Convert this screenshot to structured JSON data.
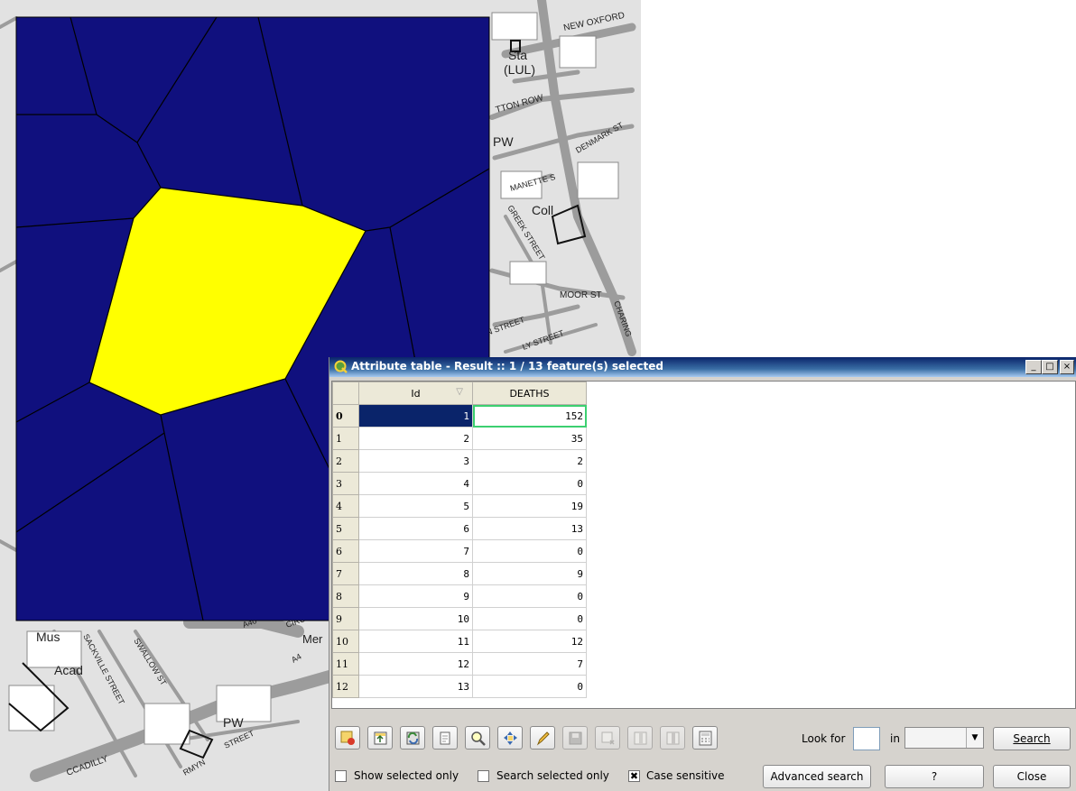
{
  "map": {
    "labels": [
      "Sta",
      "(LUL)",
      "NEW OXFORD",
      "TTON ROW",
      "PW",
      "DENMARK ST",
      "MANETTE S",
      "Coll",
      "GREEK STREET",
      "MOOR ST",
      "CHARING",
      "N STREET",
      "LY STREET",
      "Mus",
      "Acad",
      "SACKVILLE STREET",
      "SWALLOW ST",
      "A4",
      "Mer",
      "PW",
      "STREET",
      "CCADILLY",
      "RMYN",
      "CIRCE",
      "A40"
    ],
    "colors": {
      "polygon_fill": "#10107e",
      "selected_fill": "#ffff00",
      "edge": "#000000",
      "background": "#e4e4e4",
      "road": "#9a9a9a"
    }
  },
  "window": {
    "title": "Attribute table - Result :: 1 / 13 feature(s) selected",
    "minimize": "_",
    "maximize": "□",
    "close": "×"
  },
  "table": {
    "columns": [
      "Id",
      "DEATHS"
    ],
    "rows": [
      {
        "row": "0",
        "id": "1",
        "deaths": "152"
      },
      {
        "row": "1",
        "id": "2",
        "deaths": "35"
      },
      {
        "row": "2",
        "id": "3",
        "deaths": "2"
      },
      {
        "row": "3",
        "id": "4",
        "deaths": "0"
      },
      {
        "row": "4",
        "id": "5",
        "deaths": "19"
      },
      {
        "row": "5",
        "id": "6",
        "deaths": "13"
      },
      {
        "row": "6",
        "id": "7",
        "deaths": "0"
      },
      {
        "row": "7",
        "id": "8",
        "deaths": "9"
      },
      {
        "row": "8",
        "id": "9",
        "deaths": "0"
      },
      {
        "row": "9",
        "id": "10",
        "deaths": "0"
      },
      {
        "row": "10",
        "id": "11",
        "deaths": "12"
      },
      {
        "row": "11",
        "id": "12",
        "deaths": "7"
      },
      {
        "row": "12",
        "id": "13",
        "deaths": "0"
      }
    ]
  },
  "toolbar": {
    "tools": [
      "remove-selection-icon",
      "move-selection-to-top-icon",
      "invert-selection-icon",
      "copy-selected-rows-icon",
      "zoom-to-selection-icon",
      "pan-to-selection-icon",
      "toggle-editing-icon",
      "save-edits-icon",
      "delete-selected-icon",
      "new-column-icon",
      "delete-column-icon",
      "field-calculator-icon"
    ],
    "look_for_label": "Look for",
    "in_label": "in",
    "search_label": "Search",
    "show_selected_label": "Show selected only",
    "search_selected_label": "Search selected only",
    "case_sensitive_label": "Case sensitive",
    "case_sensitive_mark": "✖",
    "advanced_search_label": "Advanced search",
    "help_label": "?",
    "close_label": "Close"
  }
}
